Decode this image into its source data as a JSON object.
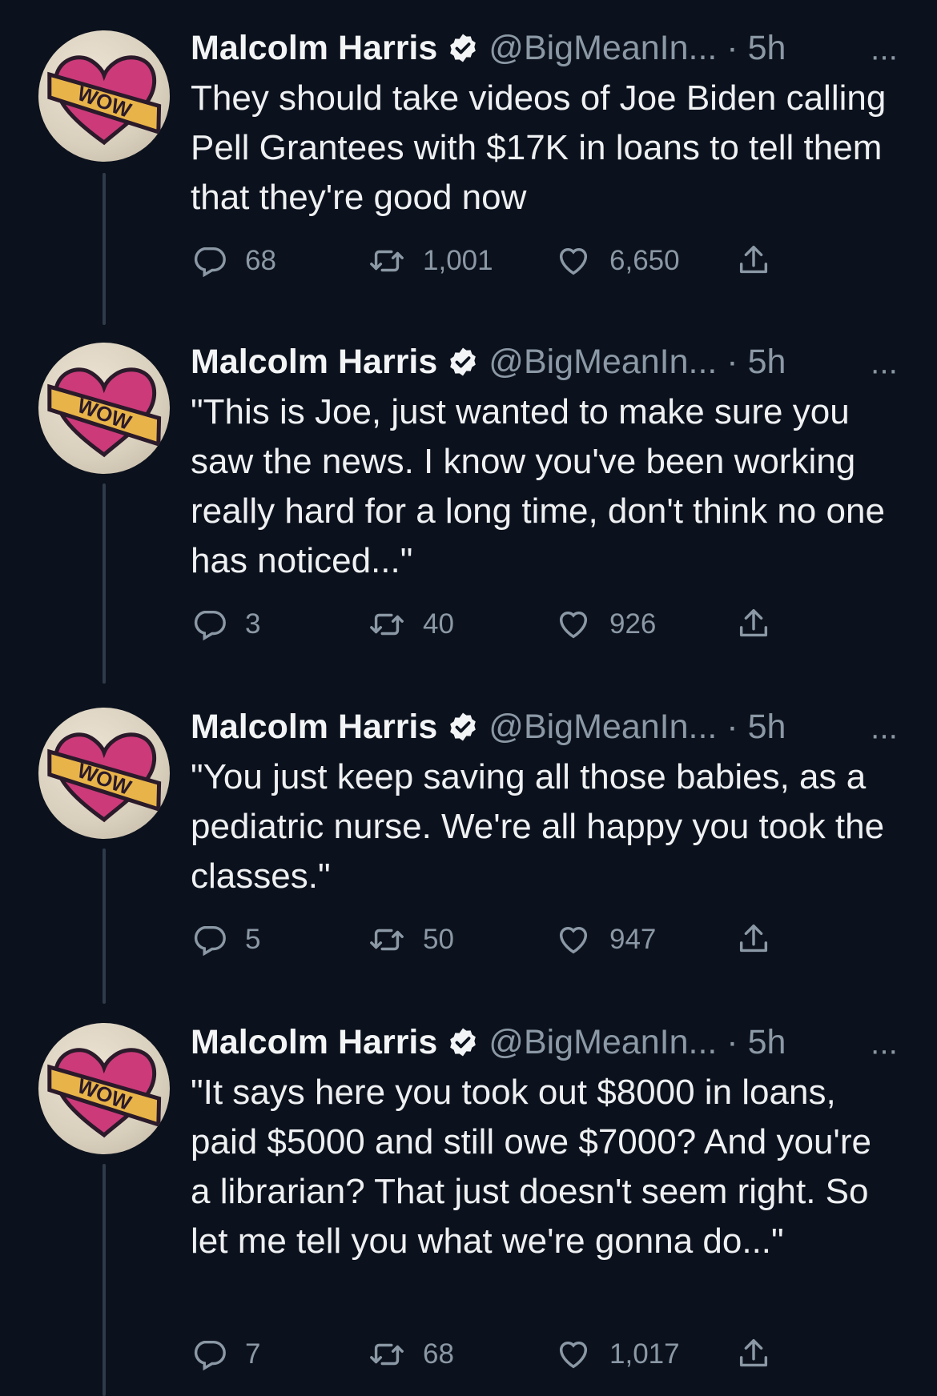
{
  "tweets": [
    {
      "name": "Malcolm Harris",
      "handle": "@BigMeanIn... · 5h",
      "more": "···",
      "text": "They should take videos of Joe Biden calling Pell Grantees with $17K in loans to tell them that they're good now",
      "replies": "68",
      "retweets": "1,001",
      "likes": "6,650"
    },
    {
      "name": "Malcolm Harris",
      "handle": "@BigMeanIn... · 5h",
      "more": "···",
      "text": "\"This is Joe, just wanted to make sure you saw the news. I know you've been working really hard for a long time, don't think no one has noticed...\"",
      "replies": "3",
      "retweets": "40",
      "likes": "926"
    },
    {
      "name": "Malcolm Harris",
      "handle": "@BigMeanIn... · 5h",
      "more": "···",
      "text": "\"You just keep saving all those babies, as a pediatric nurse. We're all happy you took the classes.\"",
      "replies": "5",
      "retweets": "50",
      "likes": "947"
    },
    {
      "name": "Malcolm Harris",
      "handle": "@BigMeanIn... · 5h",
      "more": "···",
      "text": "\"It says here you took out $8000 in loans, paid $5000 and still owe $7000? And you're a librarian? That just doesn't seem right. So let me tell you what we're gonna do...\"",
      "replies": "7",
      "retweets": "68",
      "likes": "1,017"
    }
  ],
  "avatar_label": "WOW",
  "icons": {
    "reply": "reply-icon",
    "retweet": "retweet-icon",
    "like": "like-icon",
    "share": "share-icon",
    "verified": "verified-badge-icon",
    "more": "more-options-icon"
  },
  "colors": {
    "background": "#0c121d",
    "text": "#e7e9ea",
    "secondary": "#8b98a5",
    "thread_line": "#2f3a4a"
  }
}
